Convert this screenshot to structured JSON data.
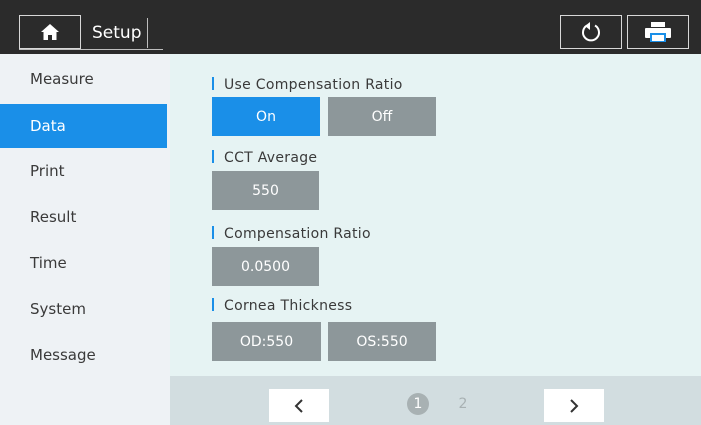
{
  "header": {
    "title": "Setup",
    "home_icon": "home-icon",
    "refresh_icon": "refresh-icon",
    "print_icon": "printer-icon"
  },
  "sidebar": {
    "items": [
      {
        "label": "Measure",
        "active": false
      },
      {
        "label": "Data",
        "active": true
      },
      {
        "label": "Print",
        "active": false
      },
      {
        "label": "Result",
        "active": false
      },
      {
        "label": "Time",
        "active": false
      },
      {
        "label": "System",
        "active": false
      },
      {
        "label": "Message",
        "active": false
      }
    ]
  },
  "settings": {
    "compensation_toggle": {
      "label": "Use Compensation Ratio",
      "on_label": "On",
      "off_label": "Off",
      "selected": "On"
    },
    "cct_average": {
      "label": "CCT Average",
      "value": "550"
    },
    "compensation_ratio": {
      "label": "Compensation Ratio",
      "value": "0.0500"
    },
    "cornea_thickness": {
      "label": "Cornea Thickness",
      "od_value": "OD:550",
      "os_value": "OS:550"
    }
  },
  "pagination": {
    "current_page": "1",
    "other_page": "2",
    "prev_icon": "chevron-left-icon",
    "next_icon": "chevron-right-icon"
  },
  "colors": {
    "accent": "#1a8fe8",
    "button_gray": "#8d979a",
    "topbar": "#2b2b2b",
    "content_bg": "#e6f3f3",
    "sidebar_bg": "#eef2f5"
  }
}
